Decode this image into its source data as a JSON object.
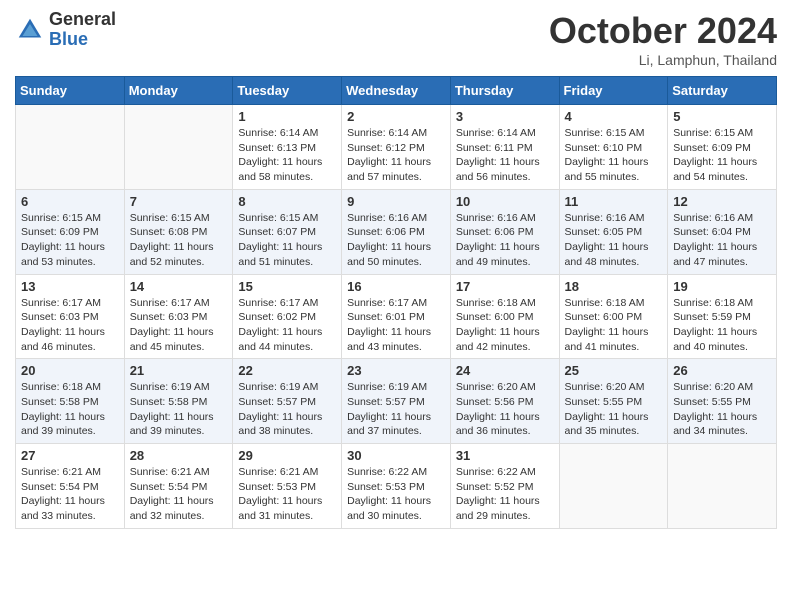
{
  "header": {
    "logo_general": "General",
    "logo_blue": "Blue",
    "month_title": "October 2024",
    "location": "Li, Lamphun, Thailand"
  },
  "weekdays": [
    "Sunday",
    "Monday",
    "Tuesday",
    "Wednesday",
    "Thursday",
    "Friday",
    "Saturday"
  ],
  "weeks": [
    [
      {
        "day": "",
        "info": ""
      },
      {
        "day": "",
        "info": ""
      },
      {
        "day": "1",
        "info": "Sunrise: 6:14 AM\nSunset: 6:13 PM\nDaylight: 11 hours and 58 minutes."
      },
      {
        "day": "2",
        "info": "Sunrise: 6:14 AM\nSunset: 6:12 PM\nDaylight: 11 hours and 57 minutes."
      },
      {
        "day": "3",
        "info": "Sunrise: 6:14 AM\nSunset: 6:11 PM\nDaylight: 11 hours and 56 minutes."
      },
      {
        "day": "4",
        "info": "Sunrise: 6:15 AM\nSunset: 6:10 PM\nDaylight: 11 hours and 55 minutes."
      },
      {
        "day": "5",
        "info": "Sunrise: 6:15 AM\nSunset: 6:09 PM\nDaylight: 11 hours and 54 minutes."
      }
    ],
    [
      {
        "day": "6",
        "info": "Sunrise: 6:15 AM\nSunset: 6:09 PM\nDaylight: 11 hours and 53 minutes."
      },
      {
        "day": "7",
        "info": "Sunrise: 6:15 AM\nSunset: 6:08 PM\nDaylight: 11 hours and 52 minutes."
      },
      {
        "day": "8",
        "info": "Sunrise: 6:15 AM\nSunset: 6:07 PM\nDaylight: 11 hours and 51 minutes."
      },
      {
        "day": "9",
        "info": "Sunrise: 6:16 AM\nSunset: 6:06 PM\nDaylight: 11 hours and 50 minutes."
      },
      {
        "day": "10",
        "info": "Sunrise: 6:16 AM\nSunset: 6:06 PM\nDaylight: 11 hours and 49 minutes."
      },
      {
        "day": "11",
        "info": "Sunrise: 6:16 AM\nSunset: 6:05 PM\nDaylight: 11 hours and 48 minutes."
      },
      {
        "day": "12",
        "info": "Sunrise: 6:16 AM\nSunset: 6:04 PM\nDaylight: 11 hours and 47 minutes."
      }
    ],
    [
      {
        "day": "13",
        "info": "Sunrise: 6:17 AM\nSunset: 6:03 PM\nDaylight: 11 hours and 46 minutes."
      },
      {
        "day": "14",
        "info": "Sunrise: 6:17 AM\nSunset: 6:03 PM\nDaylight: 11 hours and 45 minutes."
      },
      {
        "day": "15",
        "info": "Sunrise: 6:17 AM\nSunset: 6:02 PM\nDaylight: 11 hours and 44 minutes."
      },
      {
        "day": "16",
        "info": "Sunrise: 6:17 AM\nSunset: 6:01 PM\nDaylight: 11 hours and 43 minutes."
      },
      {
        "day": "17",
        "info": "Sunrise: 6:18 AM\nSunset: 6:00 PM\nDaylight: 11 hours and 42 minutes."
      },
      {
        "day": "18",
        "info": "Sunrise: 6:18 AM\nSunset: 6:00 PM\nDaylight: 11 hours and 41 minutes."
      },
      {
        "day": "19",
        "info": "Sunrise: 6:18 AM\nSunset: 5:59 PM\nDaylight: 11 hours and 40 minutes."
      }
    ],
    [
      {
        "day": "20",
        "info": "Sunrise: 6:18 AM\nSunset: 5:58 PM\nDaylight: 11 hours and 39 minutes."
      },
      {
        "day": "21",
        "info": "Sunrise: 6:19 AM\nSunset: 5:58 PM\nDaylight: 11 hours and 39 minutes."
      },
      {
        "day": "22",
        "info": "Sunrise: 6:19 AM\nSunset: 5:57 PM\nDaylight: 11 hours and 38 minutes."
      },
      {
        "day": "23",
        "info": "Sunrise: 6:19 AM\nSunset: 5:57 PM\nDaylight: 11 hours and 37 minutes."
      },
      {
        "day": "24",
        "info": "Sunrise: 6:20 AM\nSunset: 5:56 PM\nDaylight: 11 hours and 36 minutes."
      },
      {
        "day": "25",
        "info": "Sunrise: 6:20 AM\nSunset: 5:55 PM\nDaylight: 11 hours and 35 minutes."
      },
      {
        "day": "26",
        "info": "Sunrise: 6:20 AM\nSunset: 5:55 PM\nDaylight: 11 hours and 34 minutes."
      }
    ],
    [
      {
        "day": "27",
        "info": "Sunrise: 6:21 AM\nSunset: 5:54 PM\nDaylight: 11 hours and 33 minutes."
      },
      {
        "day": "28",
        "info": "Sunrise: 6:21 AM\nSunset: 5:54 PM\nDaylight: 11 hours and 32 minutes."
      },
      {
        "day": "29",
        "info": "Sunrise: 6:21 AM\nSunset: 5:53 PM\nDaylight: 11 hours and 31 minutes."
      },
      {
        "day": "30",
        "info": "Sunrise: 6:22 AM\nSunset: 5:53 PM\nDaylight: 11 hours and 30 minutes."
      },
      {
        "day": "31",
        "info": "Sunrise: 6:22 AM\nSunset: 5:52 PM\nDaylight: 11 hours and 29 minutes."
      },
      {
        "day": "",
        "info": ""
      },
      {
        "day": "",
        "info": ""
      }
    ]
  ]
}
